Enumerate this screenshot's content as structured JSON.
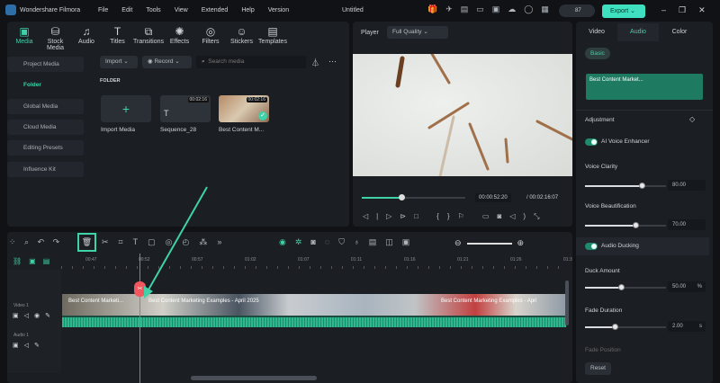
{
  "app": {
    "name": "Wondershare Filmora",
    "title": "Untitled",
    "menu": [
      "File",
      "Edit",
      "Tools",
      "View",
      "Extended",
      "Help",
      "Version"
    ],
    "credits": "87",
    "export": "Export"
  },
  "toolbar": [
    {
      "label": "Media",
      "icon": "media-icon"
    },
    {
      "label": "Stock Media",
      "icon": "stock-icon"
    },
    {
      "label": "Audio",
      "icon": "music-icon"
    },
    {
      "label": "Titles",
      "icon": "titles-icon"
    },
    {
      "label": "Transitions",
      "icon": "transitions-icon"
    },
    {
      "label": "Effects",
      "icon": "effects-icon"
    },
    {
      "label": "Filters",
      "icon": "filters-icon"
    },
    {
      "label": "Stickers",
      "icon": "stickers-icon"
    },
    {
      "label": "Templates",
      "icon": "templates-icon"
    }
  ],
  "sidebar": {
    "items": [
      "Project Media",
      "Folder",
      "Global Media",
      "Cloud Media",
      "Editing Presets",
      "Influence Kit"
    ]
  },
  "media": {
    "import": "Import",
    "record": "Record",
    "search_placeholder": "Search media",
    "folder_label": "FOLDER",
    "items": [
      {
        "name": "Import Media"
      },
      {
        "name": "Sequence_28",
        "duration": "00:02:16"
      },
      {
        "name": "Best Content M...",
        "duration": "00:02:16"
      }
    ]
  },
  "player": {
    "label": "Player",
    "quality": "Full Quality",
    "current": "00:00:52:20",
    "total": "/ 00:02:16:07",
    "progress": 0.38
  },
  "right": {
    "tabs": [
      "Video",
      "Audio",
      "Color"
    ],
    "active_tab": "Audio",
    "basic": "Basic",
    "clip": "Best Content Market...",
    "adjustment": "Adjustment",
    "ai_voice": "AI Voice Enhancer",
    "voice_clarity": {
      "label": "Voice Clarity",
      "value": "80.00"
    },
    "voice_beautification": {
      "label": "Voice Beautification",
      "value": "70.00"
    },
    "audio_ducking": "Audio Ducking",
    "duck_amount": {
      "label": "Duck Amount",
      "value": "50.00",
      "unit": "%"
    },
    "fade_duration": {
      "label": "Fade Duration",
      "value": "2.00",
      "unit": "s"
    },
    "fade_position": "Fade Position",
    "reset": "Reset"
  },
  "timeline": {
    "ruler": [
      "00:47",
      "00:52",
      "00:57",
      "01:02",
      "01:07",
      "01:11",
      "01:16",
      "01:21",
      "01:26",
      "01:3"
    ],
    "tracks": [
      "Video 1",
      "Audio 1"
    ],
    "clips": [
      "Best Content Marketi...",
      "Best Content Marketing Examples - April 2025",
      "Best Content Marketing Examples - Apri"
    ]
  },
  "colors": {
    "accent": "#3fd1a8",
    "playhead": "#f0575e"
  }
}
